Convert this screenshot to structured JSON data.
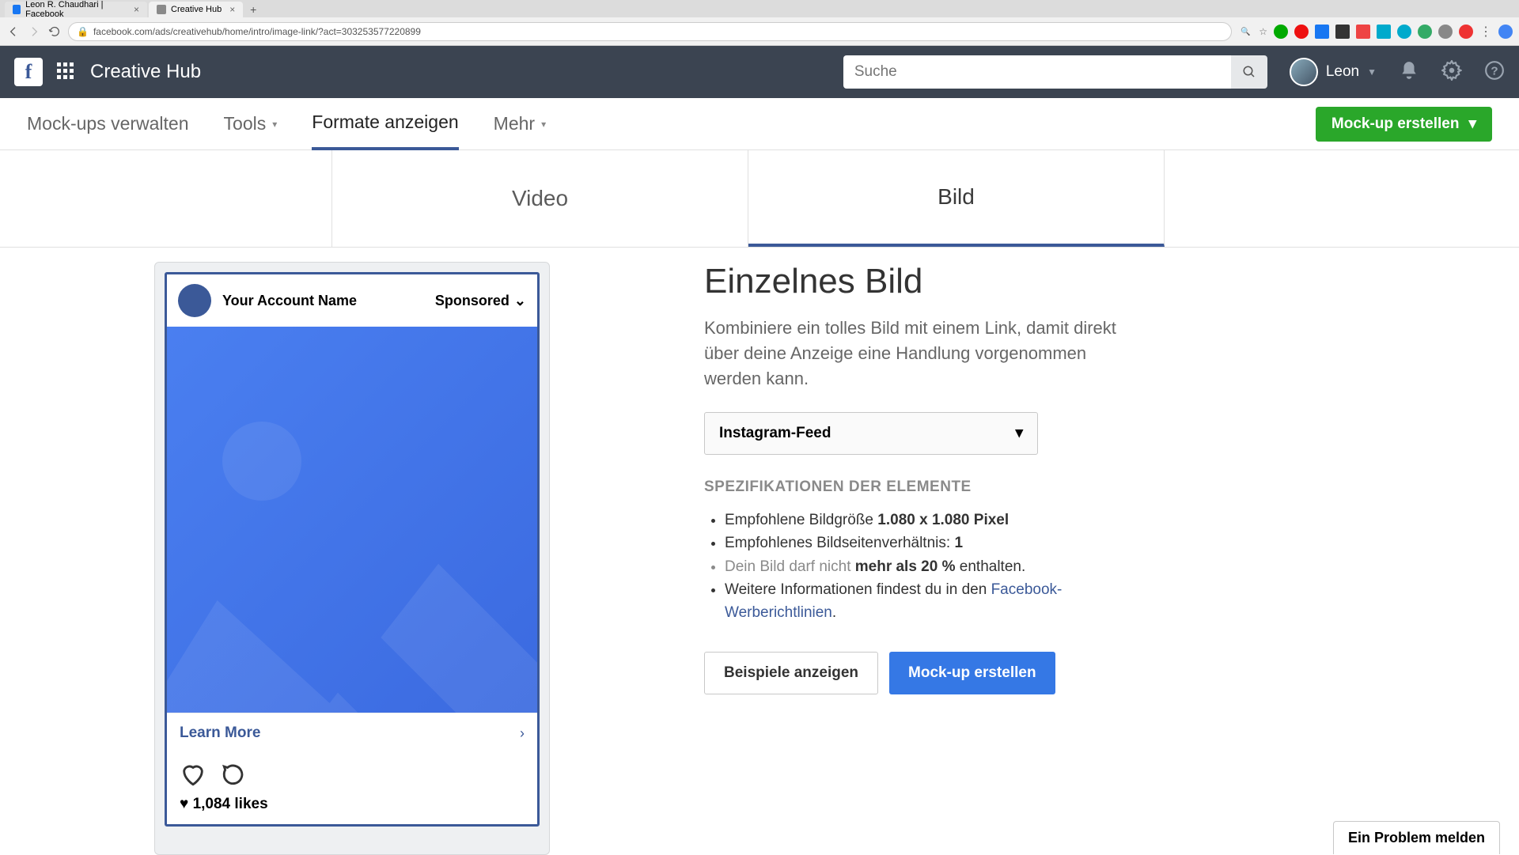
{
  "browser": {
    "tabs": [
      {
        "title": "Leon R. Chaudhari | Facebook",
        "active": false
      },
      {
        "title": "Creative Hub",
        "active": true
      }
    ],
    "url": "facebook.com/ads/creativehub/home/intro/image-link/?act=303253577220899"
  },
  "header": {
    "app_title": "Creative Hub",
    "search_placeholder": "Suche",
    "user_name": "Leon"
  },
  "nav": {
    "manage": "Mock-ups verwalten",
    "tools": "Tools",
    "formats": "Formate anzeigen",
    "more": "Mehr",
    "create_button": "Mock-up erstellen"
  },
  "format_tabs": {
    "video": "Video",
    "image": "Bild"
  },
  "preview": {
    "account_name": "Your Account Name",
    "sponsored": "Sponsored",
    "cta": "Learn More",
    "likes_prefix": "♥",
    "likes": "1,084 likes"
  },
  "detail": {
    "title": "Einzelnes Bild",
    "description": "Kombiniere ein tolles Bild mit einem Link, damit direkt über deine Anzeige eine Handlung vorgenommen werden kann.",
    "placement": "Instagram-Feed",
    "spec_heading": "SPEZIFIKATIONEN DER ELEMENTE",
    "spec_line1_a": "Empfohlene Bildgröße ",
    "spec_line1_b": "1.080 x 1.080 Pixel",
    "spec_line2_a": "Empfohlenes Bildseitenverhältnis: ",
    "spec_line2_b": "1",
    "spec_line3_a": "Dein Bild darf nicht ",
    "spec_line3_b": "mehr als 20 %",
    "spec_line3_c": " enthalten.",
    "spec_line4_a": "Weitere Informationen findest du in den ",
    "spec_line4_link": "Facebook-Werberichtlinien",
    "spec_line4_b": ".",
    "btn_examples": "Beispiele anzeigen",
    "btn_create": "Mock-up erstellen"
  },
  "report_button": "Ein Problem melden"
}
